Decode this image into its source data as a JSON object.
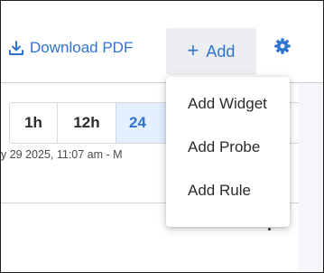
{
  "header": {
    "download_label": "Download PDF",
    "add_label": "Add",
    "accent_color": "#2f74d0"
  },
  "time_ranges": [
    "1h",
    "12h",
    "24"
  ],
  "active_range": "24",
  "date_range_text": "y 29 2025, 11:07 am - M",
  "add_menu": {
    "items": [
      "Add Widget",
      "Add Probe",
      "Add Rule"
    ]
  },
  "icons": {
    "download": "download-icon",
    "plus": "plus-icon",
    "settings": "gear-icon"
  }
}
